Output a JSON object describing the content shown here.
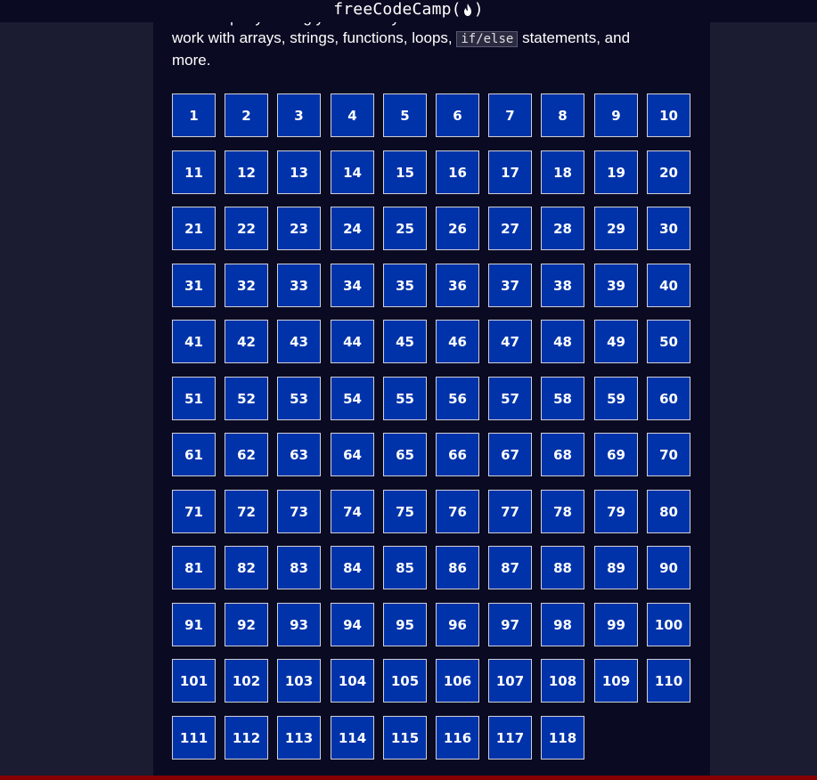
{
  "navbar": {
    "brand_text": "freeCodeCamp",
    "brand_open": "(",
    "brand_close": ")"
  },
  "intro": {
    "line1": "JavaScript by coding your own Pyramid Generator. You'll learn how to",
    "line2_before": "work with arrays, strings, functions, loops, ",
    "code": "if/else",
    "line2_after": " statements, and",
    "line3": "more."
  },
  "steps": {
    "first": 1,
    "last": 118,
    "per_row": 10
  },
  "colors": {
    "step_bg": "#0033aa",
    "step_border": "#d0d0d5",
    "page_bg": "#1b1b32",
    "content_bg": "#0a0a23",
    "bottom_bar": "#850000"
  }
}
